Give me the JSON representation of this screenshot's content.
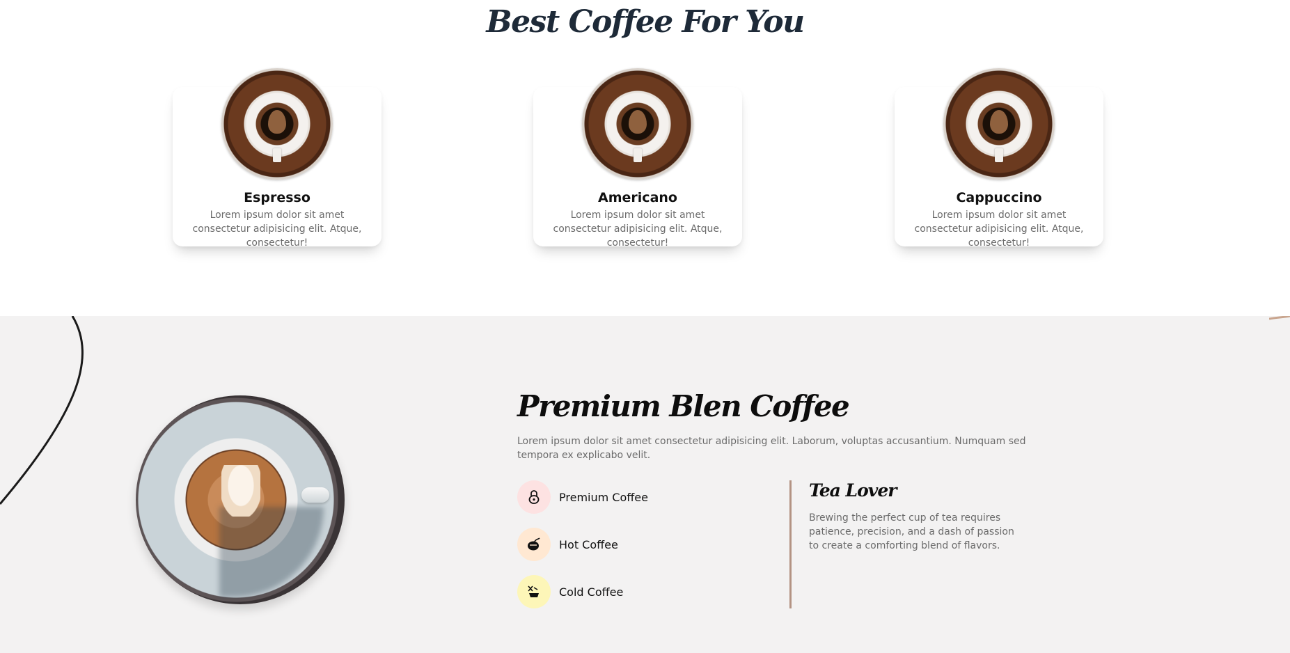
{
  "best_section": {
    "title": "Best Coffee For You",
    "cards": [
      {
        "name": "Espresso",
        "description": "Lorem ipsum dolor sit amet consectetur adipisicing elit. Atque, consectetur!"
      },
      {
        "name": "Americano",
        "description": "Lorem ipsum dolor sit amet consectetur adipisicing elit. Atque, consectetur!"
      },
      {
        "name": "Cappuccino",
        "description": "Lorem ipsum dolor sit amet consectetur adipisicing elit. Atque, consectetur!"
      }
    ]
  },
  "premium_section": {
    "title": "Premium Blen Coffee",
    "description": "Lorem ipsum dolor sit amet consectetur adipisicing elit. Laborum, voluptas accusantium. Numquam sed tempora ex explicabo velit.",
    "features": [
      {
        "label": "Premium Coffee",
        "icon": "lock-icon",
        "color": "#fde2e2"
      },
      {
        "label": "Hot Coffee",
        "icon": "hot-coffee-icon",
        "color": "#ffe8d2"
      },
      {
        "label": "Cold Coffee",
        "icon": "cold-coffee-icon",
        "color": "#fdf6b8"
      }
    ],
    "tea": {
      "title": "Tea Lover",
      "description": "Brewing the perfect cup of tea requires patience, precision, and a dash of passion to create a comforting blend of flavors."
    }
  },
  "colors": {
    "heading": "#1e2a38",
    "muted_text": "#6b6b6b",
    "section_bg": "#f3f2f2",
    "divider": "#b39383"
  }
}
